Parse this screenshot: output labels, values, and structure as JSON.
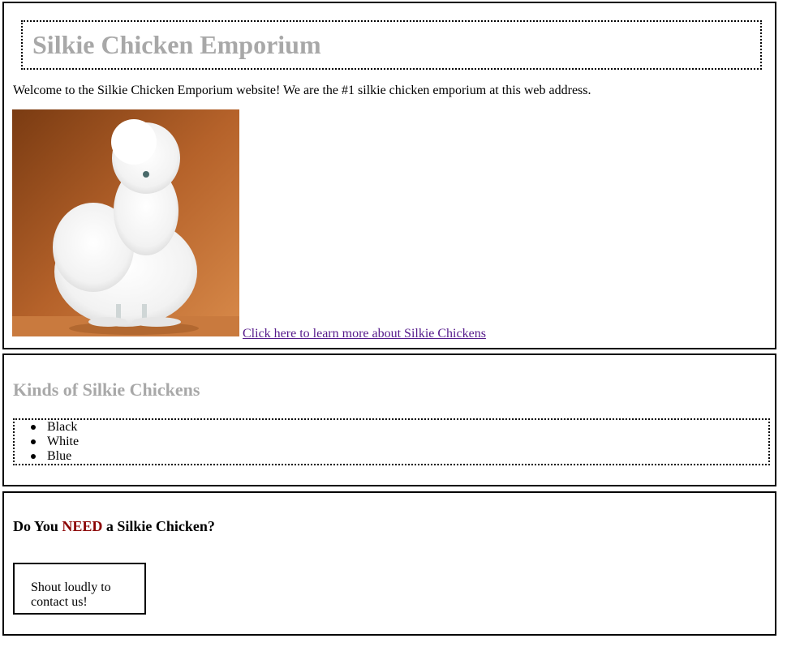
{
  "header": {
    "title": "Silkie Chicken Emporium",
    "welcome": "Welcome to the Silkie Chicken Emporium website! We are the #1 silkie chicken emporium at this web address.",
    "learn_more_link": "Click here to learn more about Silkie Chickens"
  },
  "kinds": {
    "heading": "Kinds of Silkie Chickens",
    "items": [
      "Black",
      "White",
      "Blue"
    ]
  },
  "need": {
    "heading_pre": "Do You ",
    "heading_emph": "NEED",
    "heading_post": " a Silkie Chicken?",
    "contact": "Shout loudly to contact us!"
  },
  "colors": {
    "heading_gray": "#a8a8a8",
    "need_red": "#8b0000",
    "visited_link": "#551a8b"
  }
}
